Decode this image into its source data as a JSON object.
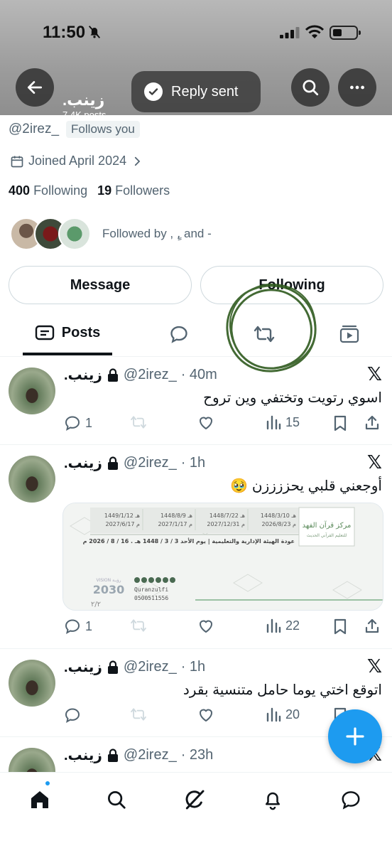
{
  "status_bar": {
    "time": "11:50"
  },
  "toast": {
    "text": "Reply sent"
  },
  "header": {
    "name": "زينب.",
    "posts_count": "7.4K posts"
  },
  "profile": {
    "handle": "@2irez_",
    "follows_you": "Follows you",
    "joined": "Joined April 2024",
    "following_count": "400",
    "following_label": "Following",
    "followers_count": "19",
    "followers_label": "Followers",
    "followed_by": "Followed by , ,ٍ and -"
  },
  "buttons": {
    "message": "Message",
    "following": "Following"
  },
  "tabs": {
    "posts": "Posts"
  },
  "posts": [
    {
      "name": "زينب.",
      "handle": "@2irez_",
      "time": "· 40m",
      "text": "اسوي رتويت وتختفي وين تروح",
      "replies": "1",
      "views": "15"
    },
    {
      "name": "زينب.",
      "handle": "@2irez_",
      "time": "· 1h",
      "text": "أوجعني قلبي يحززززن 🥹",
      "replies": "1",
      "views": "22",
      "media": {
        "org_line1": "مركز قرآن الفهد",
        "org_line2": "للتعليم القرآني الحديث",
        "dates": [
          "1449/1/12 هـ",
          "1448/8/9 هـ",
          "1448/7/22 هـ",
          "1448/3/10 هـ"
        ],
        "dates_g": [
          "2027/6/17 م",
          "2027/1/17 م",
          "2027/12/31 م",
          "2026/8/23 م"
        ],
        "return_line": "عودة الهيئة الإدارية والتعليمية  |  يوم الأحد 3 / 3 / 1448 هـ . 16 / 8 / 2026 م",
        "vision": "2030",
        "vision_label": "VISION رؤيـة",
        "handle": "Quranzulfi",
        "phone": "0500511556",
        "page": "٢/٢"
      }
    },
    {
      "name": "زينب.",
      "handle": "@2irez_",
      "time": "· 1h",
      "text": "اتوقع اختي يوما حامل متنسية بقرد",
      "replies": "",
      "views": "20"
    },
    {
      "name": "زينب.",
      "handle": "@2irez_",
      "time": "· 23h",
      "text": "",
      "replies": "",
      "views": ""
    }
  ],
  "colors": {
    "accent": "#1d9bf0",
    "text": "#0f1419",
    "muted": "#536471",
    "scribble": "#2f5a1f"
  },
  "icons": [
    "back-arrow-icon",
    "search-icon",
    "more-icon",
    "check-icon",
    "calendar-icon",
    "chevron-right-icon",
    "lock-icon",
    "x-logo-icon",
    "reply-icon",
    "repost-icon",
    "like-icon",
    "views-icon",
    "bookmark-icon",
    "share-icon",
    "compose-plus-icon",
    "home-icon",
    "grok-icon",
    "bell-icon",
    "messages-icon",
    "media-tab-icon"
  ]
}
